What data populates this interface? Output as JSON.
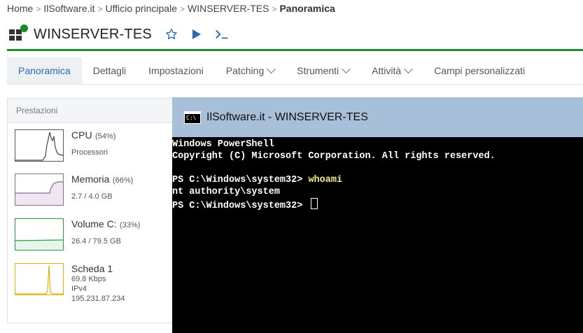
{
  "breadcrumb": {
    "items": [
      "Home",
      "IlSoftware.it",
      "Ufficio principale",
      "WINSERVER-TES"
    ],
    "current": "Panoramica"
  },
  "header": {
    "title": "WINSERVER-TES",
    "status_color": "#1a8a2a",
    "accent_color": "#1f8f2f",
    "action_icons": [
      "star-icon",
      "play-icon",
      "terminal-icon"
    ]
  },
  "tabs": [
    {
      "label": "Panoramica",
      "active": true,
      "dropdown": false
    },
    {
      "label": "Dettagli",
      "active": false,
      "dropdown": false
    },
    {
      "label": "Impostazioni",
      "active": false,
      "dropdown": false
    },
    {
      "label": "Patching",
      "active": false,
      "dropdown": true
    },
    {
      "label": "Strumenti",
      "active": false,
      "dropdown": true
    },
    {
      "label": "Attività",
      "active": false,
      "dropdown": true
    },
    {
      "label": "Campi personalizzati",
      "active": false,
      "dropdown": false
    }
  ],
  "performance": {
    "header": "Prestazioni",
    "cpu": {
      "name": "CPU",
      "percent": "(54%)",
      "sub": "Processori",
      "color": "#555555"
    },
    "memory": {
      "name": "Memoria",
      "percent": "(66%)",
      "sub": "2.7 / 4.0 GB",
      "color": "#8b6a9a"
    },
    "volume": {
      "name": "Volume C:",
      "percent": "(33%)",
      "sub": "26.4 / 79.5 GB",
      "color": "#2e9a3e"
    },
    "network": {
      "name": "Scheda 1",
      "speed": "69.8 Kbps",
      "protocol": "IPv4",
      "ip": "195.231.87.234",
      "color": "#d9b400"
    }
  },
  "terminal": {
    "title": "IlSoftware.it - WINSERVER-TES",
    "icon_text": "C:\\",
    "line1": "Windows PowerShell",
    "line2": "Copyright (C) Microsoft Corporation. All rights reserved.",
    "prompt1": "PS C:\\Windows\\system32> ",
    "command1": "whoami",
    "output1": "nt authority\\system",
    "prompt2": "PS C:\\Windows\\system32> "
  }
}
